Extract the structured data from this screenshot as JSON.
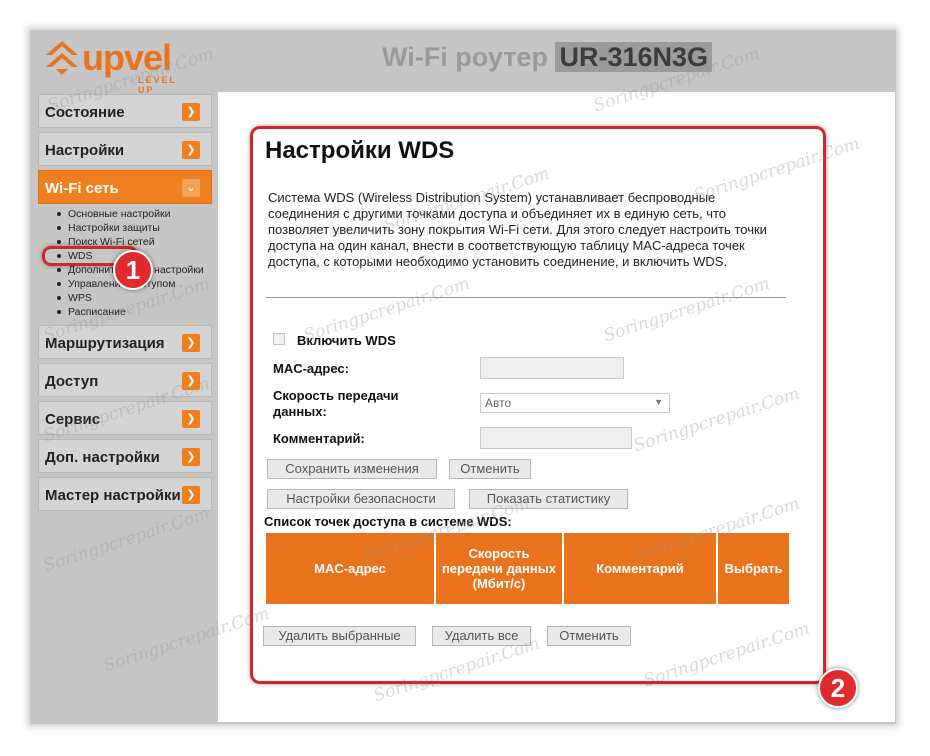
{
  "header": {
    "logo_text": "upvel",
    "logo_sub": "LEVEL UP",
    "title": "Wi-Fi роутер",
    "model": "UR-316N3G"
  },
  "sidebar": {
    "items": [
      {
        "label": "Состояние"
      },
      {
        "label": "Настройки"
      },
      {
        "label": "Wi-Fi сеть"
      },
      {
        "label": "Маршрутизация"
      },
      {
        "label": "Доступ"
      },
      {
        "label": "Сервис"
      },
      {
        "label": "Доп. настройки"
      },
      {
        "label": "Мастер настройки"
      }
    ],
    "wifi_submenu": [
      "Основные настройки",
      "Настройки защиты",
      "Поиск Wi-Fi сетей",
      "WDS",
      "Дополнительные настройки",
      "Управление доступом",
      "WPS",
      "Расписание"
    ]
  },
  "annotations": {
    "badge1": "1",
    "badge2": "2"
  },
  "main": {
    "title": "Настройки WDS",
    "description": "Система WDS (Wireless Distribution System) устанавливает беспроводные соединения с другими точками доступа и объединяет их в единую сеть, что позволяет увеличить зону покрытия Wi-Fi сети. Для этого следует настроить точки доступа на один канал, внести в соответствующую таблицу MAC-адреса точек доступа, с которыми необходимо установить соединение, и включить WDS.",
    "enable_label": "Включить WDS",
    "enable_checked": false,
    "mac_label": "MAC-адрес:",
    "mac_value": "",
    "speed_label_1": "Скорость передачи",
    "speed_label_2": "данных:",
    "speed_value": "Авто",
    "comment_label": "Комментарий:",
    "comment_value": "",
    "save_button": "Сохранить изменения",
    "cancel_button": "Отменить",
    "security_button": "Настройки безопасности",
    "stats_button": "Показать статистику",
    "list_title": "Список точек доступа в системе WDS:",
    "table_headers": [
      "MAC-адрес",
      "Скорость передачи данных (Мбит/с)",
      "Комментарий",
      "Выбрать"
    ],
    "delete_selected_button": "Удалить выбранные",
    "delete_all_button": "Удалить все",
    "cancel2_button": "Отменить"
  },
  "watermark": "Soringpcrepair.Com",
  "colors": {
    "accent": "#e8731c",
    "annotation": "#d2262b"
  }
}
